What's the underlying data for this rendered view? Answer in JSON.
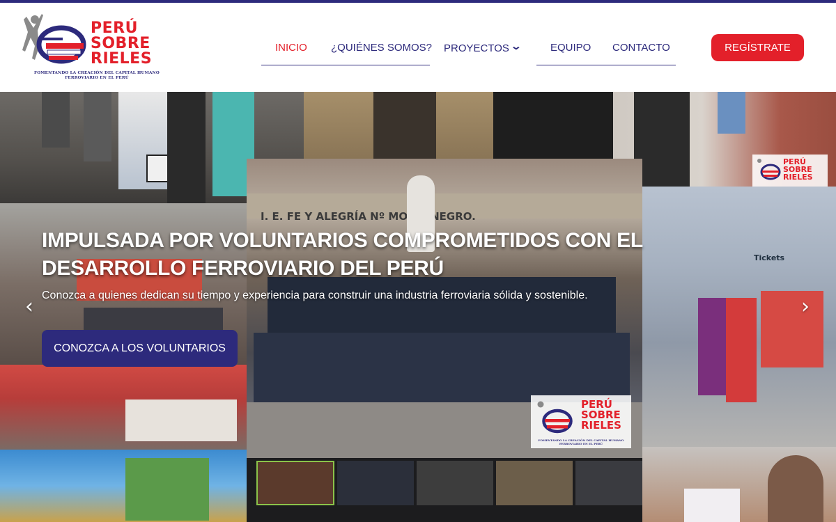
{
  "header": {
    "logo": {
      "name_line1": "PERÚ",
      "name_line2": "SOBRE",
      "name_line3": "RIELES",
      "tagline": "FOMENTANDO LA CREACIÓN DEL CAPITAL HUMANO FERROVIARIO EN EL PERÚ"
    },
    "nav": {
      "items": [
        {
          "label": "INICIO",
          "active": true
        },
        {
          "label": "¿QUIÉNES SOMOS?"
        },
        {
          "label": "PROYECTOS",
          "has_dropdown": true
        },
        {
          "label": "EQUIPO"
        },
        {
          "label": "CONTACTO"
        }
      ]
    },
    "register_label": "REGÍSTRATE"
  },
  "hero": {
    "title": "IMPULSADA POR VOLUNTARIOS COMPROMETIDOS CON EL DESARROLLO FERROVIARIO DEL PERÚ",
    "subtitle": "Conozca a quienes dedican su tiempo y experiencia para construir una industria ferroviaria sólida y sostenible.",
    "cta_label": "CONOZCA A LOS VOLUNTARIOS",
    "prev_icon": "‹",
    "next_icon": "›",
    "watermark_line1": "PERÚ",
    "watermark_line2": "SOBRE",
    "watermark_line3": "RIELES",
    "watermark_tagline": "FOMENTANDO LA CREACIÓN DEL CAPITAL HUMANO FERROVIARIO EN EL PERÚ",
    "photo_texts": {
      "school_sign": "I. E. FE Y ALEGRÍA Nº    MONTENEGRO.",
      "tickets_sign": "Tickets"
    }
  },
  "colors": {
    "brand_red": "#e3202a",
    "brand_navy": "#2d2a7c",
    "top_bar": "#2d2a7c"
  }
}
